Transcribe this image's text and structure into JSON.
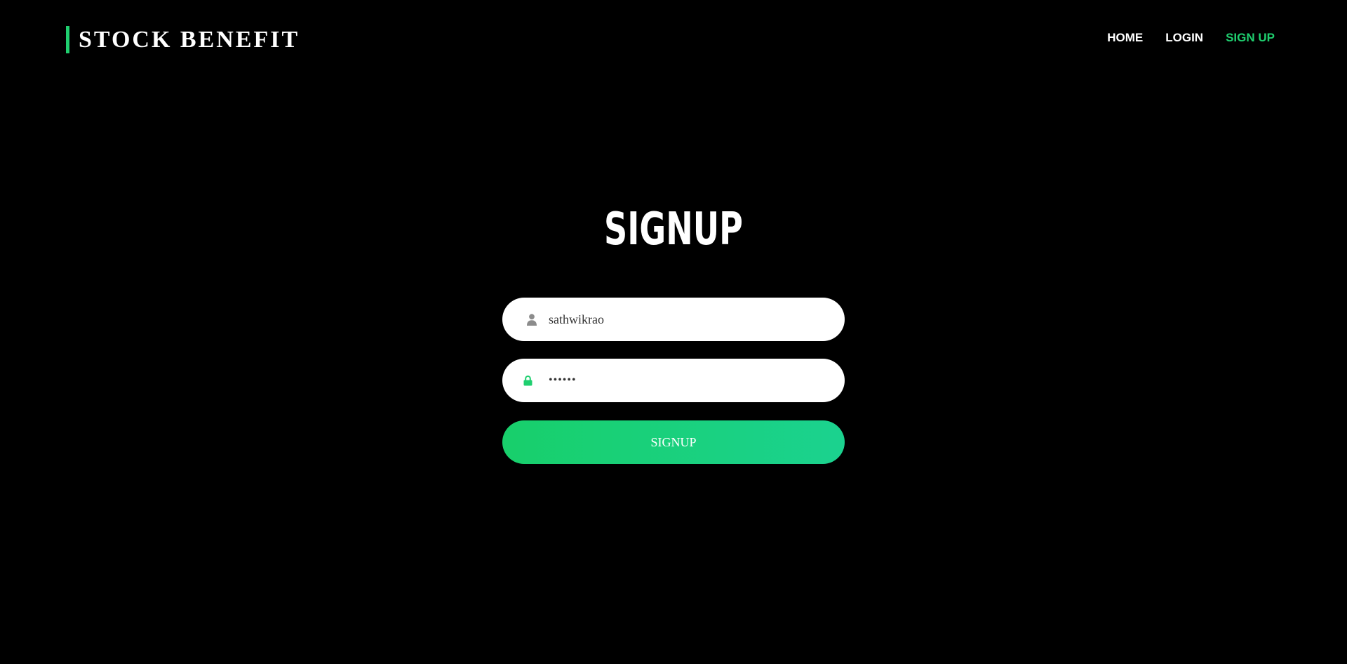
{
  "brand": {
    "name": "STOCK BENEFIT"
  },
  "nav": {
    "items": [
      {
        "label": "HOME"
      },
      {
        "label": "LOGIN"
      },
      {
        "label": "SIGN UP"
      }
    ]
  },
  "form": {
    "title": "SIGNUP",
    "username": {
      "icon": "user-icon",
      "value": "sathwikrao"
    },
    "password": {
      "icon": "lock-icon",
      "value": "••••••"
    },
    "submit_label": "SIGNUP"
  },
  "colors": {
    "accent": "#1fcf6f",
    "background": "#000000",
    "button_gradient_start": "#18cf6b",
    "button_gradient_end": "#1bd28f"
  }
}
